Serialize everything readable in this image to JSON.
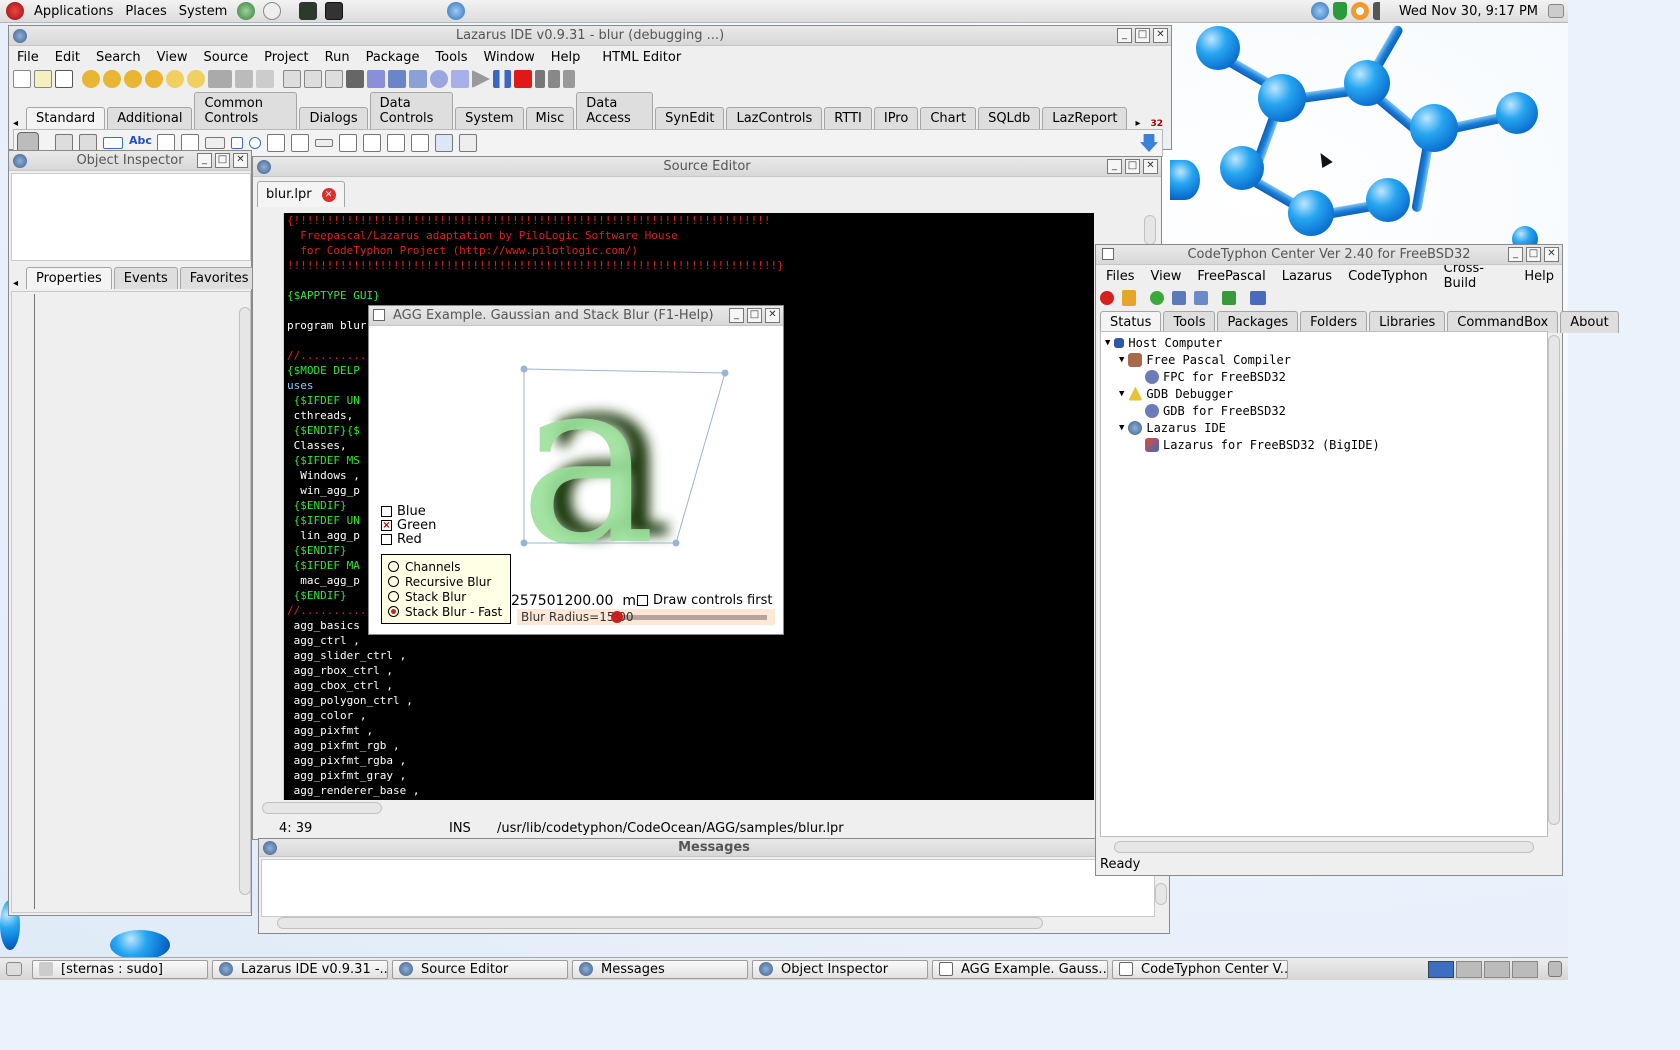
{
  "top_panel": {
    "menus": [
      "Applications",
      "Places",
      "System"
    ],
    "clock": "Wed Nov 30,  9:17 PM"
  },
  "lazarus_ide": {
    "title": "Lazarus IDE v0.9.31 - blur (debugging ...)",
    "menu": [
      "File",
      "Edit",
      "Search",
      "View",
      "Source",
      "Project",
      "Run",
      "Package",
      "Tools",
      "Window",
      "Help",
      "HTML Editor"
    ],
    "palette_tabs": [
      "Standard",
      "Additional",
      "Common Controls",
      "Dialogs",
      "Data Controls",
      "System",
      "Misc",
      "Data Access",
      "SynEdit",
      "LazControls",
      "RTTI",
      "IPro",
      "Chart",
      "SQLdb",
      "LazReport"
    ],
    "palette_badge": "32"
  },
  "object_inspector": {
    "title": "Object Inspector",
    "tabs": [
      "Properties",
      "Events",
      "Favorites"
    ]
  },
  "source_editor": {
    "title": "Source Editor",
    "file_tab": "blur.lpr",
    "lines": [
      {
        "text": "{!!!!!!!!!!!!!!!!!!!!!!!!!!!!!!!!!!!!!!!!!!!!!!!!!!!!!!!!!!!!!!!!!!!!!!!!",
        "color": "#e02020"
      },
      {
        "text": "  Freepascal/Lazarus adaptation by PiloLogic Software House",
        "color": "#e02020"
      },
      {
        "text": "  for CodeTyphon Project (http://www.pilotlogic.com/)",
        "color": "#e02020"
      },
      {
        "text": "!!!!!!!!!!!!!!!!!!!!!!!!!!!!!!!!!!!!!!!!!!!!!!!!!!!!!!!!!!!!!!!!!!!!!!!!!!}",
        "color": "#e02020"
      },
      {
        "text": "",
        "color": "#ffffff"
      },
      {
        "text": "{$APPTYPE GUI}",
        "color": "#2ee82e"
      },
      {
        "text": "",
        "color": "#ffffff"
      },
      {
        "text": "program blur",
        "color": "#ffffff"
      },
      {
        "text": "",
        "color": "#ffffff"
      },
      {
        "text": "//..........",
        "color": "#e02020"
      },
      {
        "text": "{$MODE DELP",
        "color": "#2ee82e"
      },
      {
        "text": "uses",
        "color": "#8fc8ff"
      },
      {
        "text": " {$IFDEF UN",
        "color": "#2ee82e"
      },
      {
        "text": " cthreads,",
        "color": "#ffffff"
      },
      {
        "text": " {$ENDIF}{$",
        "color": "#2ee82e"
      },
      {
        "text": " Classes,",
        "color": "#ffffff"
      },
      {
        "text": " {$IFDEF MS",
        "color": "#2ee82e"
      },
      {
        "text": "  Windows ,",
        "color": "#ffffff"
      },
      {
        "text": "  win_agg_p",
        "color": "#ffffff"
      },
      {
        "text": " {$ENDIF}",
        "color": "#2ee82e"
      },
      {
        "text": " {$IFDEF UN",
        "color": "#2ee82e"
      },
      {
        "text": "  lin_agg_p",
        "color": "#ffffff"
      },
      {
        "text": " {$ENDIF}",
        "color": "#2ee82e"
      },
      {
        "text": " {$IFDEF MA",
        "color": "#2ee82e"
      },
      {
        "text": "  mac_agg_p",
        "color": "#ffffff"
      },
      {
        "text": " {$ENDIF}",
        "color": "#2ee82e"
      },
      {
        "text": "//..........",
        "color": "#e02020"
      },
      {
        "text": " agg_basics",
        "color": "#ffffff"
      },
      {
        "text": " agg_ctrl ,",
        "color": "#ffffff"
      },
      {
        "text": " agg_slider_ctrl ,",
        "color": "#ffffff"
      },
      {
        "text": " agg_rbox_ctrl ,",
        "color": "#ffffff"
      },
      {
        "text": " agg_cbox_ctrl ,",
        "color": "#ffffff"
      },
      {
        "text": " agg_polygon_ctrl ,",
        "color": "#ffffff"
      },
      {
        "text": " agg_color ,",
        "color": "#ffffff"
      },
      {
        "text": " agg_pixfmt ,",
        "color": "#ffffff"
      },
      {
        "text": " agg_pixfmt_rgb ,",
        "color": "#ffffff"
      },
      {
        "text": " agg_pixfmt_rgba ,",
        "color": "#ffffff"
      },
      {
        "text": " agg_pixfmt_gray ,",
        "color": "#ffffff"
      },
      {
        "text": " agg_renderer_base ,",
        "color": "#ffffff"
      }
    ],
    "status_pos": "4: 39",
    "status_mode": "INS",
    "status_path": "/usr/lib/codetyphon/CodeOcean/AGG/samples/blur.lpr"
  },
  "messages": {
    "title": "Messages"
  },
  "agg_example": {
    "title": "AGG Example. Gaussian and Stack Blur (F1-Help)",
    "glyph": "a",
    "checkboxes": [
      {
        "label": "Blue",
        "checked": false
      },
      {
        "label": "Green",
        "checked": true
      },
      {
        "label": "Red",
        "checked": false
      }
    ],
    "radios": [
      {
        "label": "Channels",
        "selected": false
      },
      {
        "label": "Recursive Blur",
        "selected": false
      },
      {
        "label": "Stack Blur",
        "selected": false
      },
      {
        "label": "Stack Blur - Fast",
        "selected": true
      }
    ],
    "timing": "257501200.00  ms",
    "draw_controls_label": "Draw controls first",
    "slider_label": "Blur Radius=15.00",
    "slider_fraction": 0.37
  },
  "codetyphon_center": {
    "title": "CodeTyphon Center Ver 2.40 for FreeBSD32",
    "menu": [
      "Files",
      "View",
      "FreePascal",
      "Lazarus",
      "CodeTyphon",
      "Cross-Build",
      "Help"
    ],
    "tabs": [
      "Status",
      "Tools",
      "Packages",
      "Folders",
      "Libraries",
      "CommandBox",
      "About"
    ],
    "tree": [
      {
        "label": "Host Computer",
        "level": 0,
        "icon": "computer-icon"
      },
      {
        "label": "Free Pascal Compiler",
        "level": 1,
        "icon": "fpc-icon"
      },
      {
        "label": "FPC for FreeBSD32",
        "level": 2,
        "icon": "gear-icon"
      },
      {
        "label": "GDB Debugger",
        "level": 1,
        "icon": "gdb-icon"
      },
      {
        "label": "GDB for FreeBSD32",
        "level": 2,
        "icon": "gear-icon"
      },
      {
        "label": "Lazarus IDE",
        "level": 1,
        "icon": "lazarus-icon"
      },
      {
        "label": "Lazarus for FreeBSD32 (BigIDE)",
        "level": 2,
        "icon": "lazarus-app-icon"
      }
    ],
    "status": "Ready"
  },
  "taskbar": {
    "items": [
      "[sternas : sudo]",
      "Lazarus IDE v0.9.31 -...",
      "Source Editor",
      "Messages",
      "Object Inspector",
      "AGG Example. Gauss...",
      "CodeTyphon Center V..."
    ]
  }
}
